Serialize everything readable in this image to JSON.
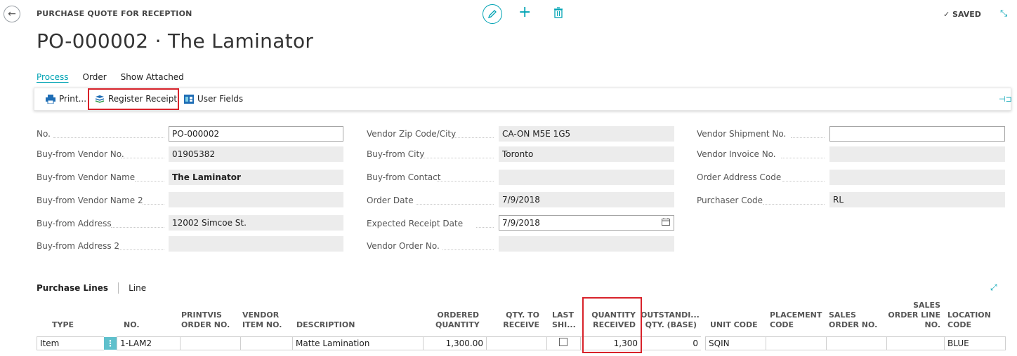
{
  "header": {
    "caption": "PURCHASE QUOTE FOR RECEPTION",
    "title": "PO-000002 · The Laminator",
    "saved": "✓ SAVED"
  },
  "tabs": [
    {
      "label": "Process",
      "active": true
    },
    {
      "label": "Order",
      "active": false
    },
    {
      "label": "Show Attached",
      "active": false
    }
  ],
  "actions": {
    "print": "Print...",
    "register_receipt": "Register Receipt",
    "user_fields": "User Fields"
  },
  "fields": {
    "col1": [
      {
        "label": "No.",
        "value": "PO-000002",
        "editable": true
      },
      {
        "label": "Buy-from Vendor No.",
        "value": "01905382"
      },
      {
        "label": "Buy-from Vendor Name",
        "value": "The Laminator",
        "bold": true
      },
      {
        "label": "Buy-from Vendor Name 2",
        "value": ""
      },
      {
        "label": "Buy-from Address",
        "value": "12002 Simcoe St."
      },
      {
        "label": "Buy-from Address 2",
        "value": ""
      }
    ],
    "col2": [
      {
        "label": "Vendor Zip Code/City",
        "value": "CA-ON M5E 1G5"
      },
      {
        "label": "Buy-from City",
        "value": "Toronto"
      },
      {
        "label": "Buy-from Contact",
        "value": ""
      },
      {
        "label": "Order Date",
        "value": "7/9/2018"
      },
      {
        "label": "Expected Receipt Date",
        "value": "7/9/2018",
        "editable": true
      },
      {
        "label": "Vendor Order No.",
        "value": ""
      }
    ],
    "col3": [
      {
        "label": "Vendor Shipment No.",
        "value": "",
        "editable": true
      },
      {
        "label": "Vendor Invoice No.",
        "value": ""
      },
      {
        "label": "Order Address Code",
        "value": ""
      },
      {
        "label": "Purchaser Code",
        "value": "RL"
      }
    ]
  },
  "lines": {
    "title": "Purchase Lines",
    "link": "Line",
    "columns": {
      "type": "TYPE",
      "no": "NO.",
      "printvis_1": "PRINTVIS",
      "printvis_2": "ORDER NO.",
      "vendor_item_1": "VENDOR",
      "vendor_item_2": "ITEM NO.",
      "description": "DESCRIPTION",
      "ordered_1": "ORDERED",
      "ordered_2": "QUANTITY",
      "qty_to_receive_1": "QTY. TO",
      "qty_to_receive_2": "RECEIVE",
      "last_shi_1": "LAST",
      "last_shi_2": "SHI...",
      "qty_received_1": "QUANTITY",
      "qty_received_2": "RECEIVED",
      "outstanding_1": "OUTSTANDI...",
      "outstanding_2": "QTY. (BASE)",
      "unit_code": "UNIT CODE",
      "placement_1": "PLACEMENT",
      "placement_2": "CODE",
      "sales_order_1": "SALES",
      "sales_order_2": "ORDER NO.",
      "sales_line_1": "SALES",
      "sales_line_2": "ORDER LINE",
      "sales_line_3": "NO.",
      "location_1": "LOCATION",
      "location_2": "CODE"
    },
    "rows": [
      {
        "type": "Item",
        "no": "1-LAM2",
        "printvis": "",
        "vendor_item": "",
        "description": "Matte Lamination",
        "ordered_quantity": "1,300.00",
        "qty_to_receive": "",
        "last_shipment": false,
        "quantity_received": "1,300",
        "outstanding_qty": "0",
        "unit_code": "SQIN",
        "placement_code": "",
        "sales_order_no": "",
        "sales_order_line_no": "",
        "location_code": "BLUE"
      }
    ]
  }
}
